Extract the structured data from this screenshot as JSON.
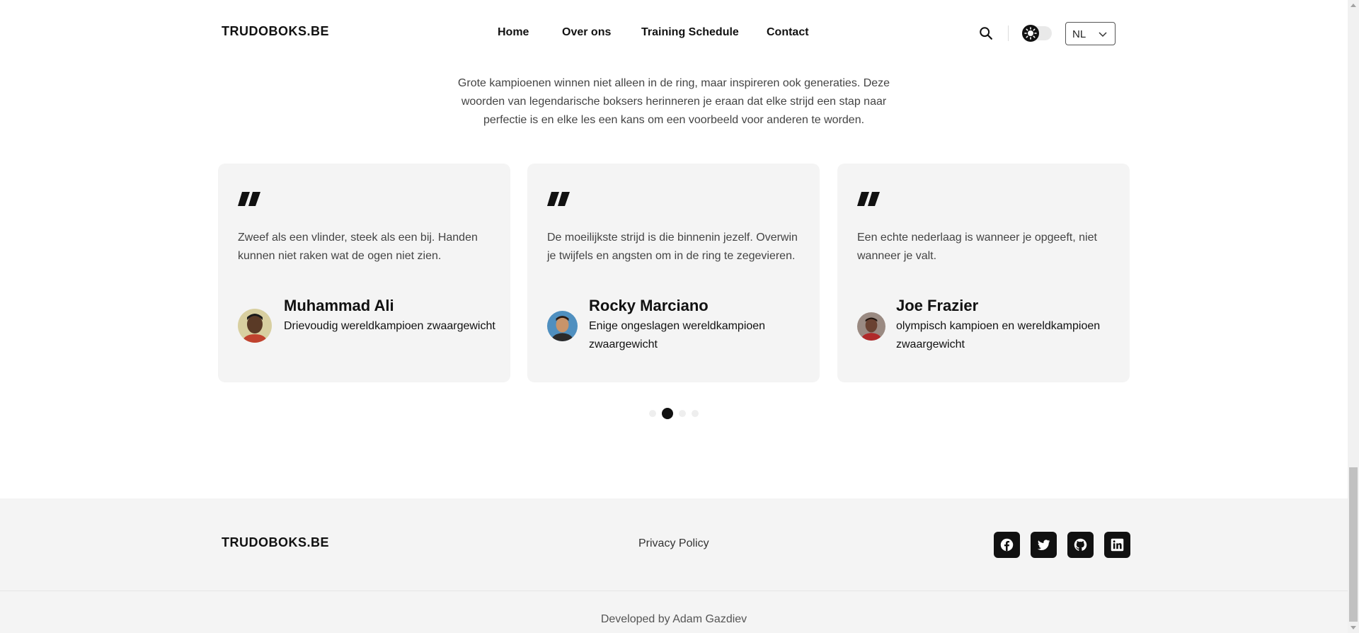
{
  "header": {
    "logo": "TRUDOBOKS.BE",
    "nav": [
      {
        "label": "Home"
      },
      {
        "label": "Over ons"
      },
      {
        "label": "Training Schedule"
      },
      {
        "label": "Contact"
      }
    ],
    "search_icon": "search-icon",
    "theme_icon": "sun-icon",
    "language": {
      "selected": "NL"
    }
  },
  "intro": {
    "text": "Grote kampioenen winnen niet alleen in de ring, maar inspireren ook generaties. Deze woorden van legendarische boksers herinneren je eraan dat elke strijd een stap naar perfectie is en elke les een kans om een voorbeeld voor anderen te worden."
  },
  "testimonials": [
    {
      "quote": "Zweef als een vlinder, steek als een bij. Handen kunnen niet raken wat de ogen niet zien.",
      "name": "Muhammad Ali",
      "title": "Drievoudig wereldkampioen zwaargewicht"
    },
    {
      "quote": "De moeilijkste strijd is die binnenin jezelf. Overwin je twijfels en angsten om in de ring te zegevieren.",
      "name": "Rocky Marciano",
      "title": "Enige ongeslagen wereldkampioen zwaargewicht"
    },
    {
      "quote": "Een echte nederlaag is wanneer je opgeeft, niet wanneer je valt.",
      "name": "Joe Frazier",
      "title": "olympisch kampioen en wereldkampioen zwaargewicht"
    }
  ],
  "carousel": {
    "slides": 4,
    "active_index": 1
  },
  "footer": {
    "logo": "TRUDOBOKS.BE",
    "privacy_label": "Privacy Policy",
    "social": [
      "facebook-icon",
      "twitter-icon",
      "github-icon",
      "linkedin-icon"
    ],
    "credit": "Developed by Adam Gazdiev"
  },
  "colors": {
    "accent": "#111111",
    "card_bg": "#f4f4f4",
    "footer_bg": "#f4f4f4"
  }
}
